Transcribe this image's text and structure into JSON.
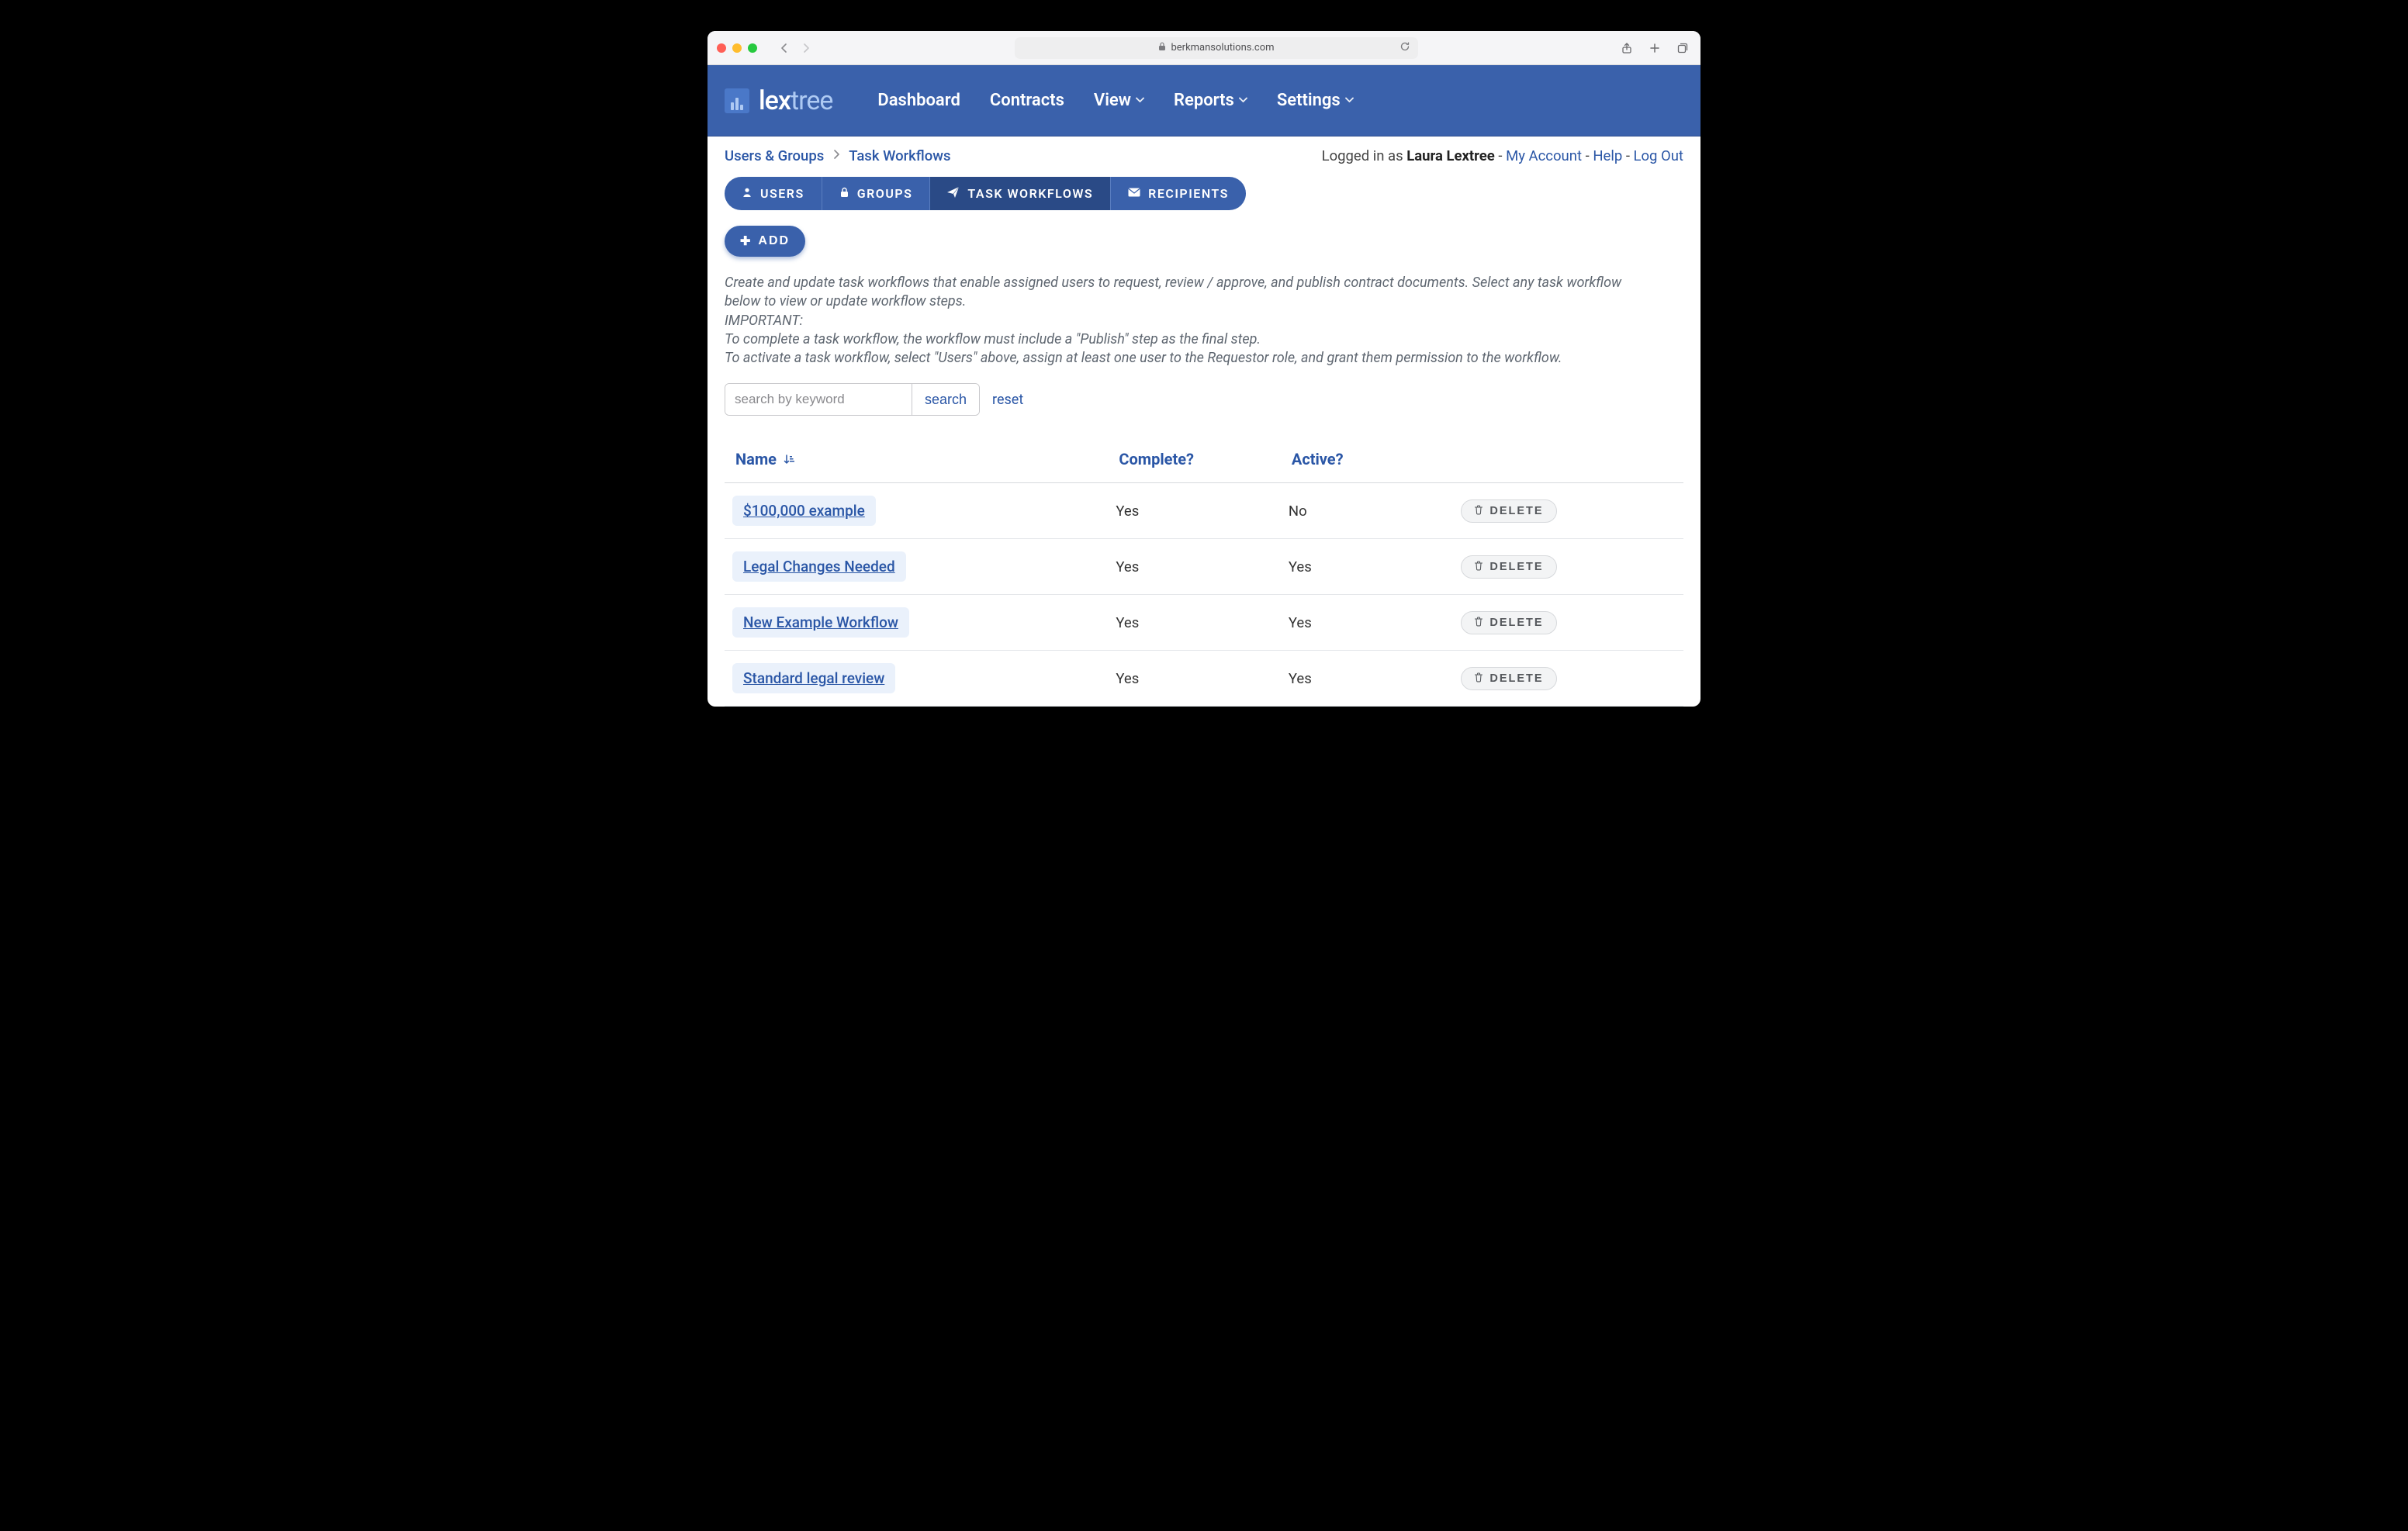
{
  "browser": {
    "domain": "berkmansolutions.com"
  },
  "brand": {
    "logo_prefix": "lex",
    "logo_suffix": "tree"
  },
  "nav": {
    "items": [
      {
        "label": "Dashboard",
        "dropdown": false
      },
      {
        "label": "Contracts",
        "dropdown": false
      },
      {
        "label": "View",
        "dropdown": true
      },
      {
        "label": "Reports",
        "dropdown": true
      },
      {
        "label": "Settings",
        "dropdown": true
      }
    ]
  },
  "breadcrumb": {
    "root": "Users & Groups",
    "current": "Task Workflows"
  },
  "auth": {
    "prefix": "Logged in as ",
    "user": "Laura Lextree",
    "my_account": "My Account",
    "help": "Help",
    "logout": "Log Out"
  },
  "tabs": {
    "items": [
      {
        "id": "users",
        "label": "USERS",
        "icon": "user",
        "active": false
      },
      {
        "id": "groups",
        "label": "GROUPS",
        "icon": "lock",
        "active": false
      },
      {
        "id": "task-workflows",
        "label": "TASK WORKFLOWS",
        "icon": "plane",
        "active": true
      },
      {
        "id": "recipients",
        "label": "RECIPIENTS",
        "icon": "mail",
        "active": false
      }
    ]
  },
  "add_button": "ADD",
  "help_text": {
    "line1": "Create and update task workflows that enable assigned users to request, review / approve, and publish contract documents. Select any task workflow below to view or update workflow steps.",
    "line2": "IMPORTANT:",
    "line3": "To complete a task workflow, the workflow must include a \"Publish\" step as the final step.",
    "line4": "To activate a task workflow, select \"Users\" above, assign at least one user to the Requestor role, and grant them permission to the workflow."
  },
  "search": {
    "placeholder": "search by keyword",
    "button": "search",
    "reset": "reset"
  },
  "table": {
    "headers": {
      "name": "Name",
      "complete": "Complete?",
      "active": "Active?"
    },
    "delete_label": "DELETE",
    "rows": [
      {
        "name": "$100,000 example",
        "complete": "Yes",
        "active": "No"
      },
      {
        "name": "Legal Changes Needed",
        "complete": "Yes",
        "active": "Yes"
      },
      {
        "name": "New Example Workflow",
        "complete": "Yes",
        "active": "Yes"
      },
      {
        "name": "Standard legal review",
        "complete": "Yes",
        "active": "Yes"
      }
    ]
  }
}
